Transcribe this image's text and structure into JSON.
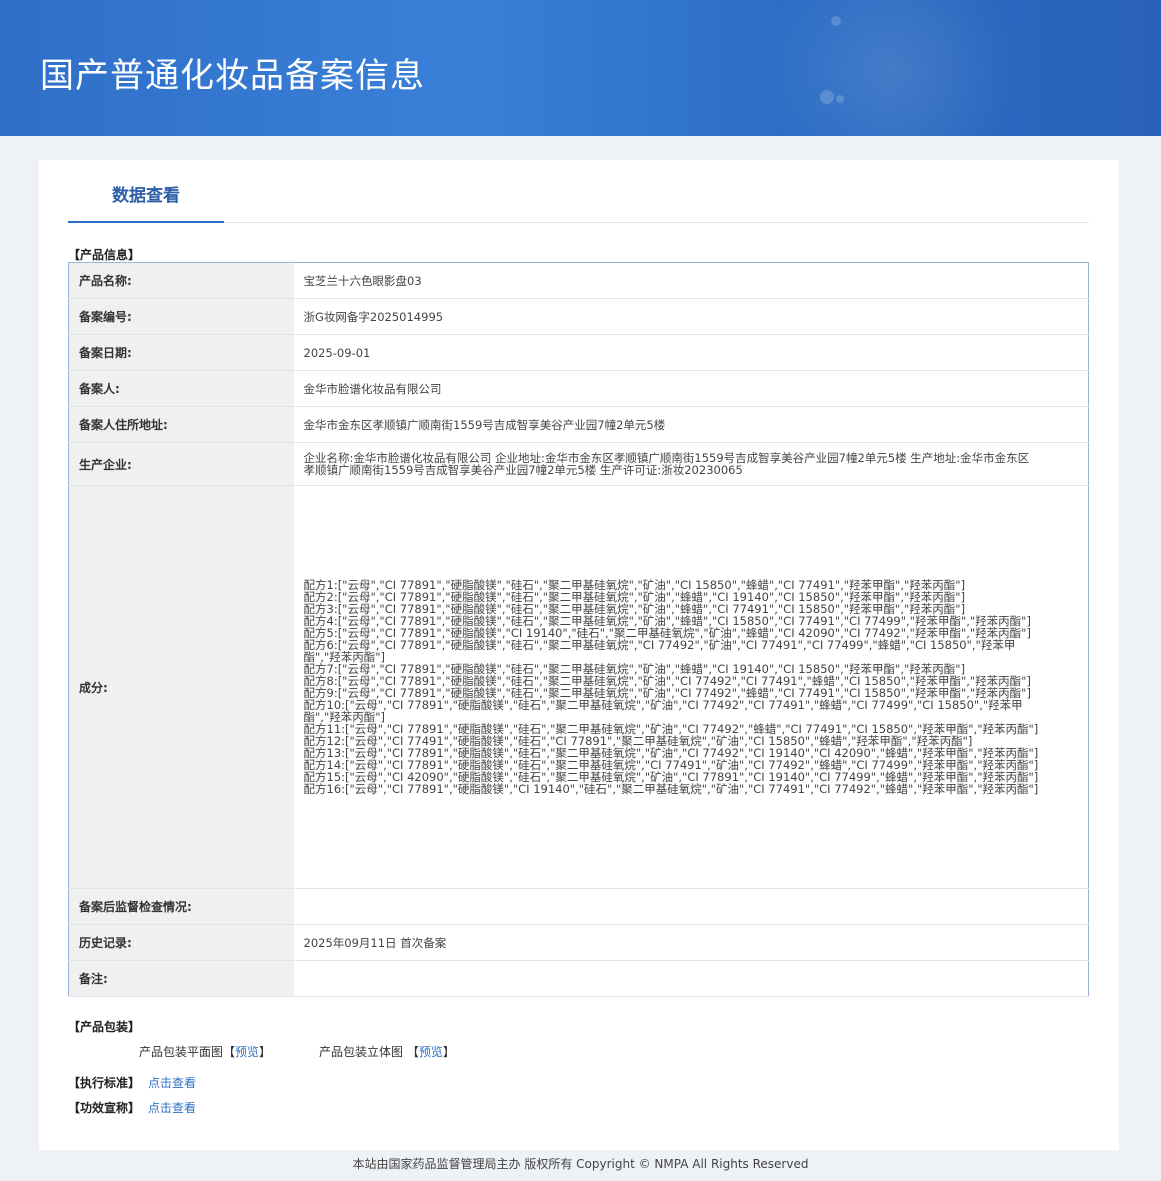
{
  "header": {
    "title": "国产普通化妆品备案信息"
  },
  "tabs": [
    {
      "label": "数据查看"
    }
  ],
  "product_section": {
    "label": "【产品信息】",
    "rows": [
      {
        "key": "产品名称:",
        "value": "宝芝兰十六色眼影盘03"
      },
      {
        "key": "备案编号:",
        "value": "浙G妆网备字2025014995"
      },
      {
        "key": "备案日期:",
        "value": "2025-09-01"
      },
      {
        "key": "备案人:",
        "value": "金华市脸谱化妆品有限公司"
      },
      {
        "key": "备案人住所地址:",
        "value": "金华市金东区孝顺镇广顺南街1559号吉成智享美谷产业园7幢2单元5楼"
      },
      {
        "key": "生产企业:",
        "value": "企业名称:金华市脸谱化妆品有限公司 企业地址:金华市金东区孝顺镇广顺南街1559号吉成智享美谷产业园7幢2单元5楼 生产地址:金华市金东区孝顺镇广顺南街1559号吉成智享美谷产业园7幢2单元5楼 生产许可证:浙妆20230065"
      },
      {
        "key": "成分:",
        "formulas": [
          "配方1:[\"云母\",\"CI 77891\",\"硬脂酸镁\",\"硅石\",\"聚二甲基硅氧烷\",\"矿油\",\"CI 15850\",\"蜂蜡\",\"CI 77491\",\"羟苯甲酯\",\"羟苯丙酯\"]",
          "配方2:[\"云母\",\"CI 77891\",\"硬脂酸镁\",\"硅石\",\"聚二甲基硅氧烷\",\"矿油\",\"蜂蜡\",\"CI 19140\",\"CI 15850\",\"羟苯甲酯\",\"羟苯丙酯\"]",
          "配方3:[\"云母\",\"CI 77891\",\"硬脂酸镁\",\"硅石\",\"聚二甲基硅氧烷\",\"矿油\",\"蜂蜡\",\"CI 77491\",\"CI 15850\",\"羟苯甲酯\",\"羟苯丙酯\"]",
          "配方4:[\"云母\",\"CI 77891\",\"硬脂酸镁\",\"硅石\",\"聚二甲基硅氧烷\",\"矿油\",\"蜂蜡\",\"CI 15850\",\"CI 77491\",\"CI 77499\",\"羟苯甲酯\",\"羟苯丙酯\"]",
          "配方5:[\"云母\",\"CI 77891\",\"硬脂酸镁\",\"CI 19140\",\"硅石\",\"聚二甲基硅氧烷\",\"矿油\",\"蜂蜡\",\"CI 42090\",\"CI 77492\",\"羟苯甲酯\",\"羟苯丙酯\"]",
          "配方6:[\"云母\",\"CI 77891\",\"硬脂酸镁\",\"硅石\",\"聚二甲基硅氧烷\",\"CI 77492\",\"矿油\",\"CI 77491\",\"CI 77499\",\"蜂蜡\",\"CI 15850\",\"羟苯甲酯\",\"羟苯丙酯\"]",
          "配方7:[\"云母\",\"CI 77891\",\"硬脂酸镁\",\"硅石\",\"聚二甲基硅氧烷\",\"矿油\",\"蜂蜡\",\"CI 19140\",\"CI 15850\",\"羟苯甲酯\",\"羟苯丙酯\"]",
          "配方8:[\"云母\",\"CI 77891\",\"硬脂酸镁\",\"硅石\",\"聚二甲基硅氧烷\",\"矿油\",\"CI 77492\",\"CI 77491\",\"蜂蜡\",\"CI 15850\",\"羟苯甲酯\",\"羟苯丙酯\"]",
          "配方9:[\"云母\",\"CI 77891\",\"硬脂酸镁\",\"硅石\",\"聚二甲基硅氧烷\",\"矿油\",\"CI 77492\",\"蜂蜡\",\"CI 77491\",\"CI 15850\",\"羟苯甲酯\",\"羟苯丙酯\"]",
          "配方10:[\"云母\",\"CI 77891\",\"硬脂酸镁\",\"硅石\",\"聚二甲基硅氧烷\",\"矿油\",\"CI 77492\",\"CI 77491\",\"蜂蜡\",\"CI 77499\",\"CI 15850\",\"羟苯甲酯\",\"羟苯丙酯\"]",
          "配方11:[\"云母\",\"CI 77891\",\"硬脂酸镁\",\"硅石\",\"聚二甲基硅氧烷\",\"矿油\",\"CI 77492\",\"蜂蜡\",\"CI 77491\",\"CI 15850\",\"羟苯甲酯\",\"羟苯丙酯\"]",
          "配方12:[\"云母\",\"CI 77491\",\"硬脂酸镁\",\"硅石\",\"CI 77891\",\"聚二甲基硅氧烷\",\"矿油\",\"CI 15850\",\"蜂蜡\",\"羟苯甲酯\",\"羟苯丙酯\"]",
          "配方13:[\"云母\",\"CI 77891\",\"硬脂酸镁\",\"硅石\",\"聚二甲基硅氧烷\",\"矿油\",\"CI 77492\",\"CI 19140\",\"CI 42090\",\"蜂蜡\",\"羟苯甲酯\",\"羟苯丙酯\"]",
          "配方14:[\"云母\",\"CI 77891\",\"硬脂酸镁\",\"硅石\",\"聚二甲基硅氧烷\",\"CI 77491\",\"矿油\",\"CI 77492\",\"蜂蜡\",\"CI 77499\",\"羟苯甲酯\",\"羟苯丙酯\"]",
          "配方15:[\"云母\",\"CI 42090\",\"硬脂酸镁\",\"硅石\",\"聚二甲基硅氧烷\",\"矿油\",\"CI 77891\",\"CI 19140\",\"CI 77499\",\"蜂蜡\",\"羟苯甲酯\",\"羟苯丙酯\"]",
          "配方16:[\"云母\",\"CI 77891\",\"硬脂酸镁\",\"CI 19140\",\"硅石\",\"聚二甲基硅氧烷\",\"矿油\",\"CI 77491\",\"CI 77492\",\"蜂蜡\",\"羟苯甲酯\",\"羟苯丙酯\"]"
        ]
      },
      {
        "key": "备案后监督检查情况:",
        "value": ""
      },
      {
        "key": "历史记录:",
        "value": "2025年09月11日 首次备案"
      },
      {
        "key": "备注:",
        "value": ""
      }
    ]
  },
  "packaging": {
    "label": "【产品包装】",
    "flat": {
      "text": "产品包装平面图",
      "lb": "【",
      "link": "预览",
      "rb": "】"
    },
    "solid": {
      "text": "产品包装立体图",
      "lb": "【",
      "link": "预览",
      "rb": "】"
    }
  },
  "standard": {
    "label": "【执行标准】",
    "link": "点击查看"
  },
  "efficacy": {
    "label": "【功效宣称】",
    "link": "点击查看"
  },
  "footer": {
    "text": "本站由国家药品监督管理局主办 版权所有 Copyright © NMPA All Rights Reserved"
  }
}
